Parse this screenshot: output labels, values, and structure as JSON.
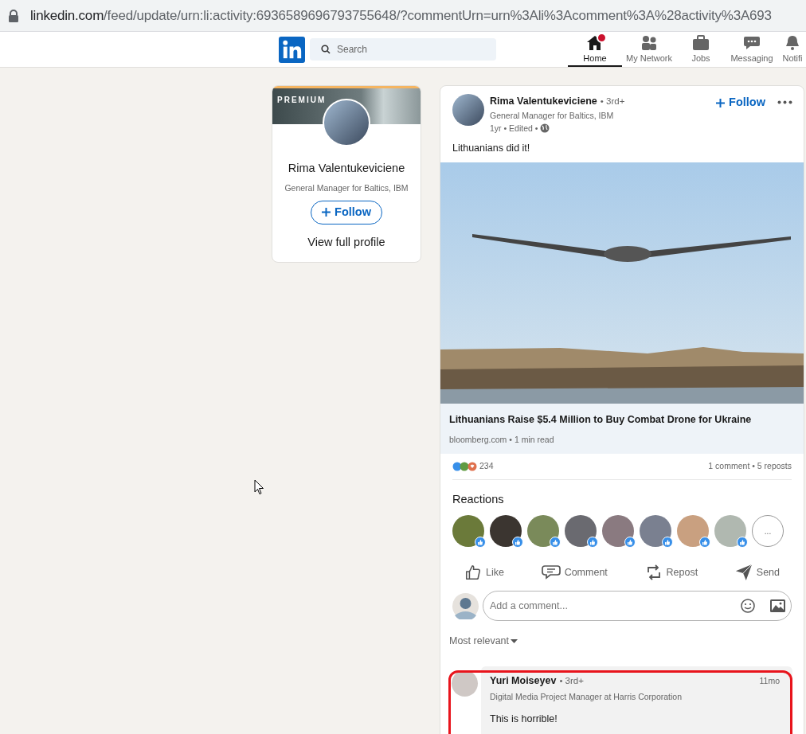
{
  "address_bar": {
    "domain": "linkedin.com",
    "path": "/feed/update/urn:li:activity:6936589696793755648/?commentUrn=urn%3Ali%3Acomment%3A%28activity%3A693"
  },
  "nav": {
    "search": {
      "placeholder": "Search"
    },
    "items": [
      {
        "label": "Home",
        "kind": "home",
        "selected": true,
        "badge": true
      },
      {
        "label": "My Network",
        "kind": "network",
        "selected": false,
        "badge": false
      },
      {
        "label": "Jobs",
        "kind": "jobs",
        "selected": false,
        "badge": false
      },
      {
        "label": "Messaging",
        "kind": "messaging",
        "selected": false,
        "badge": false
      },
      {
        "label": "Notifi",
        "kind": "notifications",
        "selected": false,
        "badge": false
      }
    ]
  },
  "profile_card": {
    "tag": "PREMIUM",
    "name": "Rima Valentukeviciene",
    "headline": "General Manager for Baltics, IBM",
    "follow": "Follow",
    "view_profile": "View full profile"
  },
  "post": {
    "author": "Rima Valentukeviciene",
    "degree": "• 3rd+",
    "headline": "General Manager for Baltics, IBM",
    "meta": "1yr • Edited •",
    "follow": "Follow",
    "text": "Lithuanians did it!",
    "article": {
      "title": "Lithuanians Raise $5.4 Million to Buy Combat Drone for Ukraine",
      "source": "bloomberg.com • 1 min read"
    },
    "reaction_count": "234",
    "stats": "1 comment • 5 reposts",
    "reactions_title": "Reactions",
    "reactors": [
      {
        "color": "#6b7a3a"
      },
      {
        "color": "#3b3530"
      },
      {
        "color": "#7a8a5a"
      },
      {
        "color": "#6a6a70"
      },
      {
        "color": "#8a7a80"
      },
      {
        "color": "#7a8090"
      },
      {
        "color": "#c9a080"
      },
      {
        "color": "#b0b8b0"
      }
    ],
    "more": "...",
    "actions": [
      {
        "label": "Like",
        "kind": "like"
      },
      {
        "label": "Comment",
        "kind": "comment"
      },
      {
        "label": "Repost",
        "kind": "repost"
      },
      {
        "label": "Send",
        "kind": "send"
      }
    ],
    "comment_box": {
      "placeholder": "Add a comment..."
    },
    "sort": "Most relevant",
    "comments": [
      {
        "author": "Yuri Moiseyev",
        "degree": "• 3rd+",
        "headline": "Digital Media Project Manager at Harris Corporation",
        "time": "11mo",
        "text": "This is horrible!",
        "highlighted": true
      }
    ]
  }
}
